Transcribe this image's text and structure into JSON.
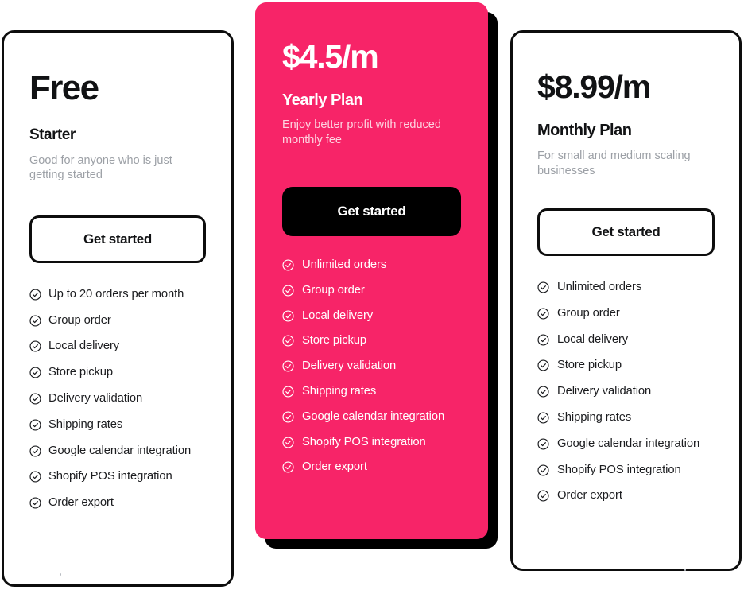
{
  "theme": {
    "accent": "#f72468",
    "ink": "#111214",
    "muted": "#9ca0a6",
    "muted_on_accent": "#fdd4e0",
    "surface": "#ffffff",
    "shadow": "#000000"
  },
  "icons": {
    "feature_check": "check-circle-icon"
  },
  "plans": [
    {
      "id": "starter",
      "price": "Free",
      "name": "Starter",
      "description": "Good for anyone who is just getting started",
      "cta_label": "Get started",
      "cta_style": "outline",
      "featured": false,
      "features": [
        "Up to 20 orders per month",
        "Group order",
        "Local delivery",
        "Store pickup",
        "Delivery validation",
        "Shipping rates",
        "Google calendar integration",
        "Shopify POS integration",
        "Order export"
      ]
    },
    {
      "id": "yearly",
      "price": "$4.5/m",
      "name": "Yearly Plan",
      "description": "Enjoy better profit with reduced monthly fee",
      "cta_label": "Get started",
      "cta_style": "solid",
      "featured": true,
      "features": [
        "Unlimited orders",
        "Group order",
        "Local delivery",
        "Store pickup",
        "Delivery validation",
        "Shipping rates",
        "Google calendar integration",
        "Shopify POS integration",
        "Order export"
      ]
    },
    {
      "id": "monthly",
      "price": "$8.99/m",
      "name": "Monthly Plan",
      "description": "For small and medium scaling businesses",
      "cta_label": "Get started",
      "cta_style": "outline",
      "featured": false,
      "features": [
        "Unlimited orders",
        "Group order",
        "Local delivery",
        "Store pickup",
        "Delivery validation",
        "Shipping rates",
        "Google calendar integration",
        "Shopify POS integration",
        "Order export"
      ]
    }
  ]
}
